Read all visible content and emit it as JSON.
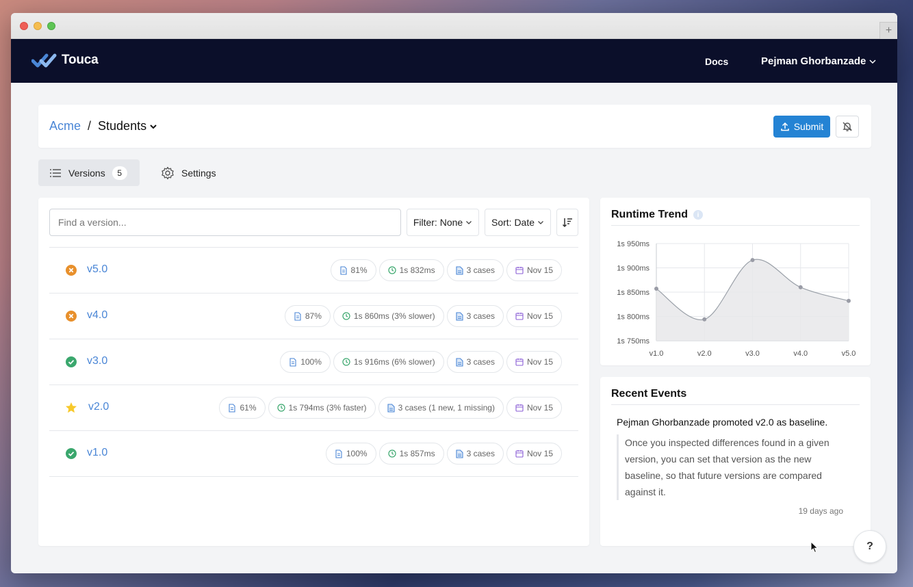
{
  "app": {
    "brand": "Touca",
    "nav": {
      "docs": "Docs",
      "user": "Pejman Ghorbanzade"
    }
  },
  "breadcrumb": {
    "team": "Acme",
    "separator": "/",
    "suite": "Students"
  },
  "actions": {
    "submit": "Submit"
  },
  "tabs": {
    "versions_label": "Versions",
    "versions_count": "5",
    "settings_label": "Settings"
  },
  "search": {
    "placeholder": "Find a version..."
  },
  "controls": {
    "filter": "Filter: None",
    "sort": "Sort: Date"
  },
  "versions": [
    {
      "name": "v5.0",
      "status": "failed",
      "match": "81%",
      "runtime": "1s 832ms",
      "cases": "3 cases",
      "date": "Nov 15"
    },
    {
      "name": "v4.0",
      "status": "failed",
      "match": "87%",
      "runtime": "1s 860ms (3% slower)",
      "cases": "3 cases",
      "date": "Nov 15"
    },
    {
      "name": "v3.0",
      "status": "passed",
      "match": "100%",
      "runtime": "1s 916ms (6% slower)",
      "cases": "3 cases",
      "date": "Nov 15"
    },
    {
      "name": "v2.0",
      "status": "baseline",
      "match": "61%",
      "runtime": "1s 794ms (3% faster)",
      "cases": "3 cases (1 new, 1 missing)",
      "date": "Nov 15"
    },
    {
      "name": "v1.0",
      "status": "passed",
      "match": "100%",
      "runtime": "1s 857ms",
      "cases": "3 cases",
      "date": "Nov 15"
    }
  ],
  "trend": {
    "title": "Runtime Trend"
  },
  "chart_data": {
    "type": "area",
    "title": "Runtime Trend",
    "x": [
      "v1.0",
      "v2.0",
      "v3.0",
      "v4.0",
      "v5.0"
    ],
    "series": [
      {
        "values": [
          1857,
          1794,
          1916,
          1860,
          1832
        ]
      }
    ],
    "ylim": [
      1750,
      1950
    ],
    "yticks": [
      1750,
      1800,
      1850,
      1900,
      1950
    ],
    "ytick_labels": [
      "1s 750ms",
      "1s 800ms",
      "1s 850ms",
      "1s 900ms",
      "1s 950ms"
    ],
    "grid": true,
    "colors": {
      "line": "#9aa0a8",
      "fill": "#e7e8ea",
      "point": "#9a9ca6"
    }
  },
  "events": {
    "title": "Recent Events",
    "actor": "Pejman Ghorbanzade",
    "verb": "promoted",
    "version": "v2.0",
    "suffix": "as baseline.",
    "description": "Once you inspected differences found in a given version, you can set that version as the new baseline, so that future versions are compared against it.",
    "time": "19 days ago"
  },
  "help": {
    "label": "?"
  },
  "colors": {
    "accent": "#2483d4",
    "link": "#4a86d6",
    "navbar": "#0b0f2a",
    "failed": "#e8902c",
    "passed": "#3aa76d",
    "baseline": "#f7c92b"
  },
  "icons": {
    "match": "document-icon",
    "runtime": "clock-icon",
    "cases": "file-icon",
    "date": "calendar-icon"
  }
}
